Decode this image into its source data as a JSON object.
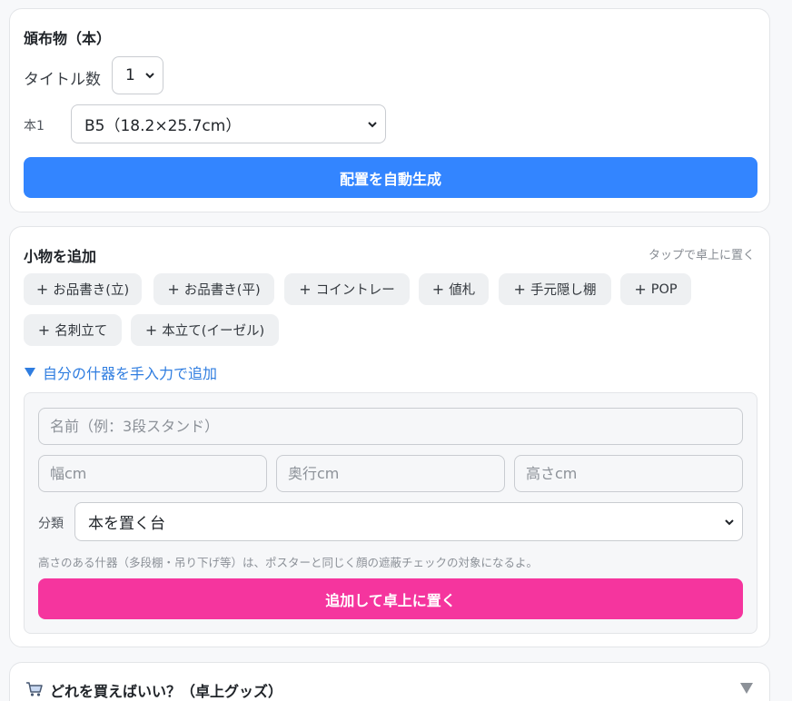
{
  "distribution": {
    "title": "頒布物（本）",
    "title_count_label": "タイトル数",
    "title_count_value": "1",
    "book_label": "本1",
    "book_size_value": "B5（18.2×25.7cm）",
    "generate_button": "配置を自動生成"
  },
  "small_items": {
    "title": "小物を追加",
    "hint": "タップで卓上に置く",
    "chips": [
      {
        "label": "お品書き(立)"
      },
      {
        "label": "お品書き(平)"
      },
      {
        "label": "コイントレー"
      },
      {
        "label": "値札"
      },
      {
        "label": "手元隠し棚"
      },
      {
        "label": "POP"
      },
      {
        "label": "名刺立て"
      },
      {
        "label": "本立て(イーゼル)"
      }
    ],
    "plus_glyph": "+",
    "custom_toggle": "自分の什器を手入力で追加",
    "custom_form": {
      "name_placeholder": "名前（例：3段スタンド）",
      "width_placeholder": "幅cm",
      "depth_placeholder": "奥行cm",
      "height_placeholder": "高さcm",
      "category_label": "分類",
      "category_value": "本を置く台",
      "note": "高さのある什器（多段棚・吊り下げ等）は、ポスターと同じく顔の遮蔽チェックの対象になるよ。",
      "add_button": "追加して卓上に置く"
    }
  },
  "shopping": {
    "title": "どれを買えばいい？（卓上グッズ）"
  },
  "colors": {
    "primary": "#3385ff",
    "accent_pink": "#f5359e",
    "link": "#2f7de0"
  }
}
